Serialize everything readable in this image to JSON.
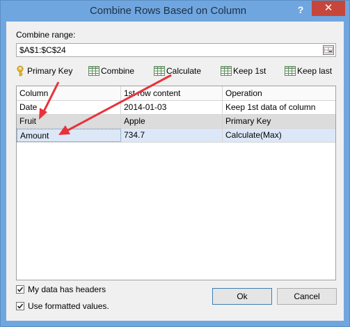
{
  "window": {
    "title": "Combine Rows Based on Column",
    "help_glyph": "?",
    "close_glyph": "✕"
  },
  "range": {
    "label": "Combine range:",
    "value": "$A$1:$C$24"
  },
  "toolbar": {
    "primary_key": "Primary Key",
    "combine": "Combine",
    "calculate": "Calculate",
    "keep_first": "Keep 1st",
    "keep_last": "Keep last"
  },
  "table": {
    "columns": [
      "Column",
      "1st row content",
      "Operation"
    ],
    "rows": [
      [
        "Date",
        "2014-01-03",
        "Keep 1st data of column"
      ],
      [
        "Fruit",
        "Apple",
        "Primary Key"
      ],
      [
        "Amount",
        "734.7",
        "Calculate(Max)"
      ]
    ]
  },
  "options": {
    "headers_label": "My data has headers",
    "headers_checked": true,
    "formatted_label": "Use formatted values.",
    "formatted_checked": true
  },
  "buttons": {
    "ok": "Ok",
    "cancel": "Cancel"
  },
  "colors": {
    "titlebar": "#6fa6e0",
    "close": "#c7463b",
    "arrow": "#e8323a"
  }
}
